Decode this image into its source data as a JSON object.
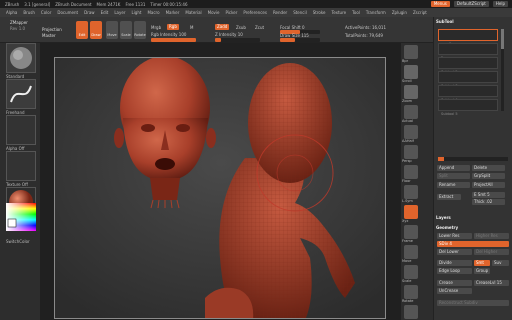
{
  "titlebar": {
    "app": "ZBrush",
    "version": "3.1 [general]",
    "doc": "ZBrush Document",
    "mem": "Mem 2471K",
    "free": "Free 1131",
    "timer": "Timer 00:00:15:46",
    "menus_label": "Menus",
    "script_label": "DefaultZScript",
    "help_label": "Help"
  },
  "menubar": [
    "Alpha",
    "Brush",
    "Color",
    "Document",
    "Draw",
    "Edit",
    "Layer",
    "Light",
    "Macro",
    "Marker",
    "Material",
    "Movie",
    "Picker",
    "Preferences",
    "Render",
    "Stencil",
    "Stroke",
    "Texture",
    "Tool",
    "Transform",
    "Zplugin",
    "Zscript"
  ],
  "toolbar": {
    "zmapper": "ZMapper",
    "rev": "Rev 1.0",
    "projection": "Projection",
    "master": "Master",
    "tools": [
      "Edit",
      "Draw",
      "Move",
      "Scale",
      "Rotate"
    ],
    "mrgb": "Mrgb",
    "rgb": "Rgb",
    "m": "M",
    "rgb_intensity": "Rgb Intensity 100",
    "zadd": "Zadd",
    "zsub": "Zsub",
    "zcut": "Zcut",
    "z_intensity": "Z Intensity 10",
    "focal_shift": "Focal Shift 0",
    "draw_size": "Draw Size 115",
    "active_points": "ActivePoints: 16,011",
    "total_points": "TotalPoints: 79,649"
  },
  "leftshelf": {
    "brush_label": "Standard",
    "stroke_label": "Freehand",
    "alpha_label": "Alpha Off",
    "texture_label": "Texture Off",
    "material_label": "MatCap",
    "color_label": "SwitchColor"
  },
  "rightshelf": [
    "Bpr",
    "Scroll",
    "Zoom",
    "Actual",
    "AAHalf",
    "Persp",
    "Floor",
    "L.Sym",
    "Xyz",
    "Frame",
    "Move",
    "Scale",
    "Rotate",
    "PolyF",
    "Transp",
    "Ghost",
    "Solo",
    "Xpose"
  ],
  "tray": {
    "subtool_title": "SubTool",
    "subtools": [
      "eyesFace",
      "Face",
      "Subtool 2",
      "Subtool 3",
      "Subtool 4",
      "Subtool 5"
    ],
    "append": "Append",
    "delete": "Delete",
    "split": "Split",
    "groupsplit": "GrpSplit",
    "rename": "Rename",
    "projectall": "ProjectAll",
    "extract": "Extract",
    "e_smt": "E Smt 5",
    "thick": "Thick .02",
    "layers_title": "Layers",
    "geometry_title": "Geometry",
    "lower_res": "Lower Res",
    "higher_res": "Higher Res",
    "sdiv": "SDiv 4",
    "del_lower": "Del Lower",
    "del_higher": "Del Higher",
    "divide": "Divide",
    "smt": "Smt",
    "suv": "Suv",
    "edge_loop": "Edge Loop",
    "group": "Group",
    "crease": "Crease",
    "crease_lvl": "CreaseLvl 15",
    "uncrease": "UnCrease",
    "reconstruct": "Reconstruct Subdiv"
  },
  "colors": {
    "accent": "#e0642c",
    "sculpt": "#b94a33",
    "bg": "#2a2a2a"
  }
}
